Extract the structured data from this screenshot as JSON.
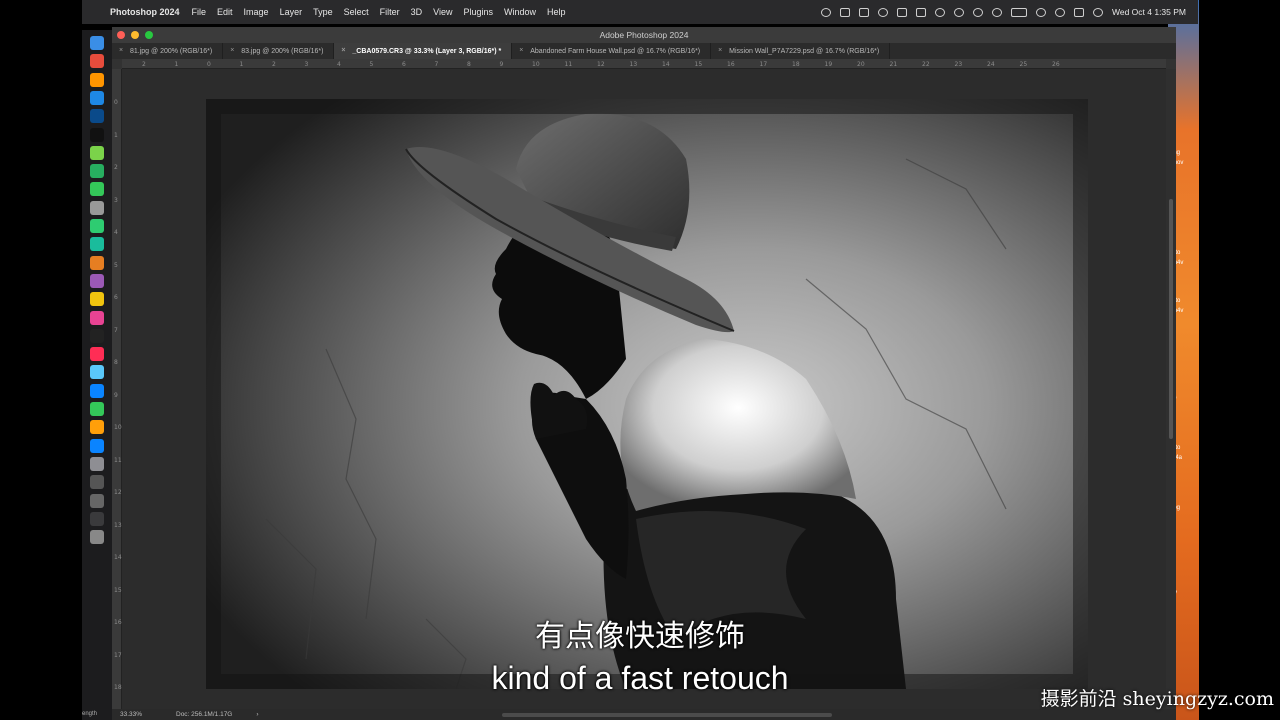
{
  "menubar": {
    "app_name": "Photoshop 2024",
    "items": [
      "File",
      "Edit",
      "Image",
      "Layer",
      "Type",
      "Select",
      "Filter",
      "3D",
      "View",
      "Plugins",
      "Window",
      "Help"
    ],
    "clock": "Wed Oct 4  1:35 PM"
  },
  "window": {
    "title": "Adobe Photoshop 2024",
    "tabs": [
      {
        "label": "81.jpg @ 200% (RGB/16*)",
        "active": false
      },
      {
        "label": "83.jpg @ 200% (RGB/16*)",
        "active": false
      },
      {
        "label": "_CBA0579.CR3 @ 33.3% (Layer 3, RGB/16*) *",
        "active": true
      },
      {
        "label": "Abandoned Farm House Wall.psd @ 16.7% (RGB/16*)",
        "active": false
      },
      {
        "label": "Mission Wall_P7A7229.psd @ 16.7% (RGB/16*)",
        "active": false
      }
    ],
    "ruler_h": [
      "2",
      "1",
      "0",
      "1",
      "2",
      "3",
      "4",
      "5",
      "6",
      "7",
      "8",
      "9",
      "10",
      "11",
      "12",
      "13",
      "14",
      "15",
      "16",
      "17",
      "18",
      "19",
      "20",
      "21",
      "22",
      "23",
      "24",
      "25",
      "26"
    ],
    "ruler_v": [
      "0",
      "1",
      "2",
      "3",
      "4",
      "5",
      "6",
      "7",
      "8",
      "9",
      "10",
      "11",
      "12",
      "13",
      "14",
      "15",
      "16",
      "17",
      "18"
    ]
  },
  "statusbar": {
    "zoom": "33.33%",
    "doc": "Doc: 256.1M/1.17G"
  },
  "desktop_labels": [
    "ing",
    "mov",
    "oto",
    "m4v",
    "oto",
    "m4v",
    "s",
    "G",
    "oto",
    "n4a",
    "jpg",
    "ry"
  ],
  "dock_label": "ength",
  "subtitles": {
    "zh": "有点像快速修饰",
    "en": "kind of a fast retouch"
  },
  "watermark": "摄影前沿 sheyingzyz.com",
  "colors": {
    "traffic_close": "#ff5f57",
    "traffic_min": "#febc2e",
    "traffic_max": "#28c840"
  }
}
